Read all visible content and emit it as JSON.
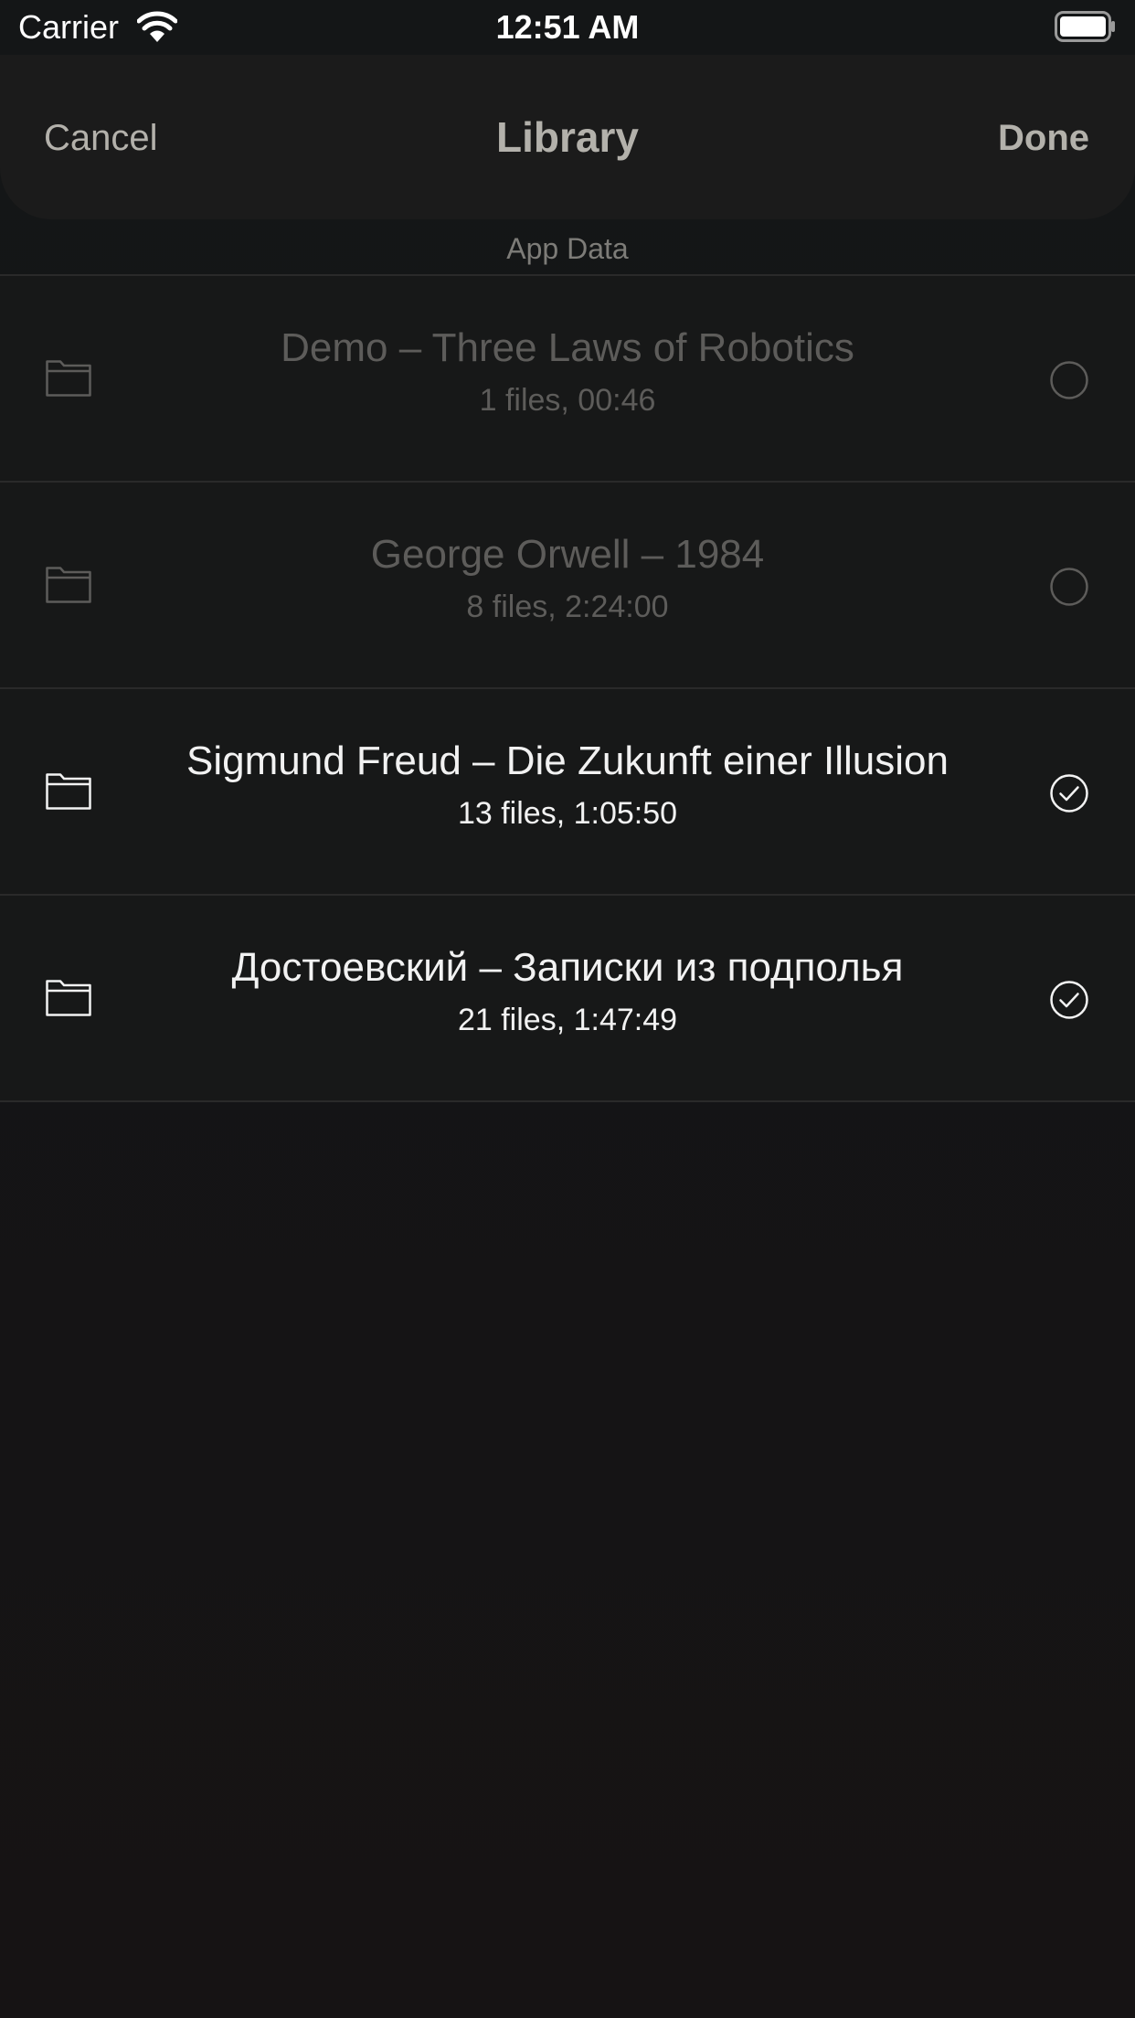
{
  "status_bar": {
    "carrier": "Carrier",
    "time": "12:51 AM"
  },
  "nav": {
    "cancel_label": "Cancel",
    "title": "Library",
    "done_label": "Done"
  },
  "section": {
    "header": "App Data"
  },
  "items": [
    {
      "title": "Demo – Three Laws of Robotics",
      "subtitle": "1 files, 00:46",
      "selected": false,
      "icon": "folder-icon"
    },
    {
      "title": "George Orwell – 1984",
      "subtitle": "8 files, 2:24:00",
      "selected": false,
      "icon": "folder-icon"
    },
    {
      "title": "Sigmund Freud – Die Zukunft einer Illusion",
      "subtitle": "13 files, 1:05:50",
      "selected": true,
      "icon": "folder-icon"
    },
    {
      "title": "Достоевский – Записки из подполья",
      "subtitle": "21 files, 1:47:49",
      "selected": true,
      "icon": "folder-icon"
    }
  ],
  "colors": {
    "background": "#151414",
    "nav_background": "#1b1b1b",
    "nav_text": "#b3b1ab",
    "dim_text": "#5d5c5a",
    "active_text": "#f2f2f2"
  }
}
